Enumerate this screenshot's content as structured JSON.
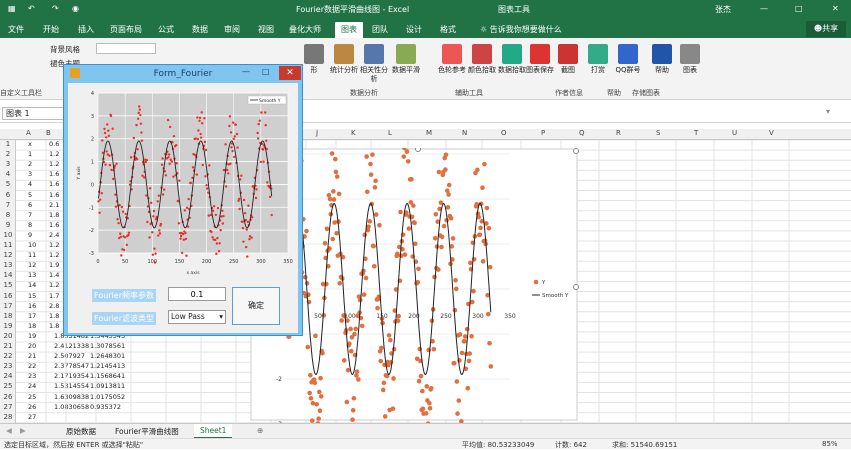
{
  "window": {
    "title": "Fourier数据平滑曲线图 - Excel",
    "context": "图表工具",
    "user": "张杰",
    "share": "共享"
  },
  "tabs": [
    "文件",
    "开始",
    "插入",
    "页面布局",
    "公式",
    "数据",
    "审阅",
    "视图",
    "叠化大师",
    "图表",
    "团队",
    "设计",
    "格式"
  ],
  "tell_me": "告诉我你想要做什么",
  "ribbon": {
    "left_items": [
      "背景风格",
      "褪色主题"
    ],
    "buttons": [
      {
        "label": "形",
        "icon_color": "#777"
      },
      {
        "label": "统计分析",
        "icon_color": "#b84"
      },
      {
        "label": "相关性分析",
        "icon_color": "#57a"
      },
      {
        "label": "数据平滑",
        "icon_color": "#8a5"
      },
      {
        "label": "色轮参考",
        "icon_color": "#e55"
      },
      {
        "label": "颜色拾取",
        "icon_color": "#c44"
      },
      {
        "label": "数据拾取",
        "icon_color": "#2a8"
      },
      {
        "label": "图表保存",
        "icon_color": "#d33"
      },
      {
        "label": "截图",
        "icon_color": "#c33"
      },
      {
        "label": "打赏",
        "icon_color": "#3a8"
      },
      {
        "label": "QQ群号",
        "icon_color": "#36c"
      },
      {
        "label": "帮助",
        "icon_color": "#25a"
      },
      {
        "label": "图表",
        "icon_color": "#888"
      }
    ],
    "groups": [
      "自定义工具栏",
      "数据分析",
      "辅助工具",
      "作者信息",
      "帮助",
      "存储图表"
    ]
  },
  "namebox": "图表 1",
  "columns": [
    "A",
    "B",
    "C",
    "D",
    "E",
    "F",
    "G",
    "H",
    "I",
    "J",
    "K",
    "L",
    "M",
    "N",
    "O",
    "P",
    "Q",
    "R",
    "S",
    "T",
    "U",
    "V"
  ],
  "rows": [
    "1",
    "2",
    "3",
    "4",
    "5",
    "6",
    "7",
    "8",
    "9",
    "10",
    "11",
    "12",
    "13",
    "14",
    "15",
    "16",
    "17",
    "18",
    "19",
    "20",
    "21",
    "22",
    "23",
    "24",
    "25",
    "26",
    "27",
    "28"
  ],
  "cells_A": [
    "x",
    "1",
    "2",
    "3",
    "4",
    "5",
    "6",
    "7",
    "8",
    "9",
    "10",
    "11",
    "12",
    "13",
    "14",
    "15",
    "16",
    "17",
    "18",
    "19",
    "20",
    "21",
    "22",
    "23",
    "24",
    "25",
    "26",
    "27"
  ],
  "cells_B": [
    "0.6",
    "1.2",
    "1.2",
    "1.6",
    "1.6",
    "1.6",
    "2.1",
    "1.8",
    "1.6",
    "2.4",
    "1.2",
    "1.2",
    "1.9",
    "1.4",
    "1.2",
    "1.7",
    "2.8",
    "1.8",
    "1.8",
    "1.8331482",
    "2.4121338",
    "2.507927",
    "2.3778547",
    "2.1719354",
    "1.5314554",
    "1.6309838",
    "1.0830658"
  ],
  "cells_C": [
    "",
    "",
    "",
    "",
    "",
    "",
    "",
    "",
    "",
    "",
    "",
    "",
    "",
    "",
    "",
    "",
    "",
    "",
    "",
    "1.3443345",
    "1.3078561",
    "1.2648301",
    "1.2145413",
    "1.1568641",
    "1.0913811",
    "1.0175052",
    "0.935372"
  ],
  "sheets": [
    "原始数据",
    "Fourier平滑曲线图",
    "Sheet1"
  ],
  "status": {
    "left": "选定目标区域，然后按 ENTER 或选择\"粘贴\"",
    "avg": "平均值: 80.53233049",
    "count": "计数: 642",
    "sum": "求和: 51540.69151",
    "zoom": "85%"
  },
  "form": {
    "title": "Form_Fourier",
    "label_freq": "Fourier频率参数",
    "value_freq": "0.1",
    "label_type": "Fourier滤波类型",
    "value_type": "Low Pass",
    "ok": "确定"
  },
  "chart_data": [
    {
      "type": "scatter",
      "title": "",
      "xlabel": "x axis",
      "ylabel": "Y axis",
      "xlim": [
        0,
        350
      ],
      "ylim": [
        -3,
        4
      ],
      "xticks": [
        "0",
        "50",
        "100",
        "150",
        "200",
        "250",
        "300",
        "350"
      ],
      "yticks": [
        "-3",
        "-2",
        "-1",
        "0",
        "1",
        "2",
        "3",
        "4"
      ],
      "series": [
        {
          "name": "Y",
          "color": "#e8302a"
        },
        {
          "name": "Smooth Y",
          "color": "#222222"
        }
      ],
      "grid": true,
      "legend": "top-right",
      "period": 57
    },
    {
      "type": "scatter",
      "title": "",
      "xlabel": "",
      "ylabel": "",
      "xlim": [
        0,
        350
      ],
      "ylim": [
        -3,
        3
      ],
      "xticks": [
        "0",
        "50",
        "100",
        "150",
        "200",
        "250",
        "300",
        "350"
      ],
      "yticks": [
        "-3",
        "-2",
        "-1",
        "0",
        "1",
        "2",
        "3"
      ],
      "series": [
        {
          "name": "Y",
          "color": "#e07040"
        },
        {
          "name": "Smooth Y",
          "color": "#222222"
        }
      ],
      "grid": false,
      "legend": "right",
      "period": 57
    }
  ]
}
